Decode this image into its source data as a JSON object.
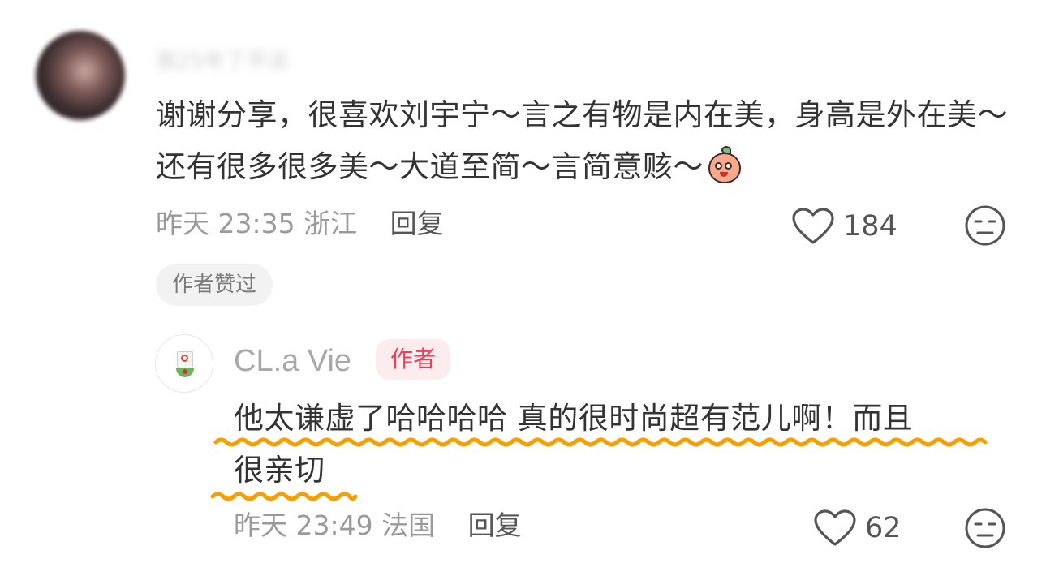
{
  "main_comment": {
    "username": "我25年了平淡",
    "text": "谢谢分享，很喜欢刘宇宁～言之有物是内在美，身高是外在美～还有很多很多美～大道至简～言简意赅～",
    "time": "昨天 23:35",
    "location": "浙江",
    "reply_label": "回复",
    "like_count": "184",
    "liked_badge": "作者赞过"
  },
  "reply": {
    "author": "CL.a Vie",
    "author_tag": "作者",
    "text_line1": "他太谦虚了哈哈哈哈 真的很时尚超有范儿啊！而且",
    "text_line2": "很亲切",
    "time": "昨天 23:49",
    "location": "法国",
    "reply_label": "回复",
    "like_count": "62"
  },
  "colors": {
    "text": "#333333",
    "meta": "#9a9a9a",
    "author_tag_text": "#e8415a",
    "author_tag_bg": "#fdecee",
    "underline": "#f5a000"
  },
  "icons": {
    "like": "heart-outline-icon",
    "dislike": "meh-face-icon",
    "sticker": "peach-sticker-icon"
  }
}
